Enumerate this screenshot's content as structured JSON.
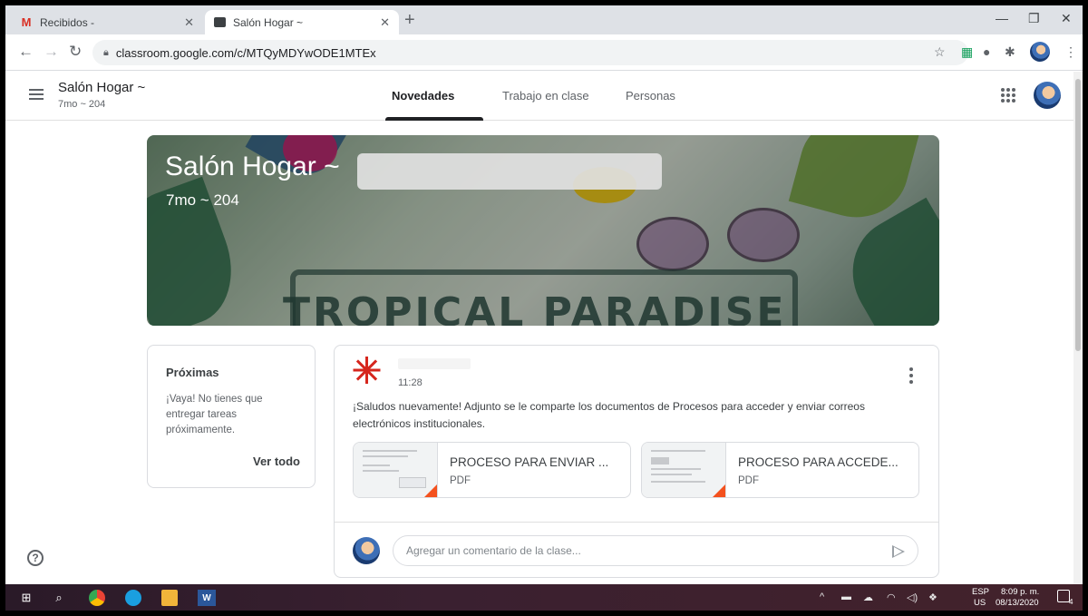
{
  "browser": {
    "tabs": [
      {
        "label": "Recibidos - ",
        "favicon": "M",
        "state": "inactive"
      },
      {
        "label": "Salón Hogar ~ ",
        "state": "active"
      }
    ],
    "url": "classroom.google.com/c/MTQyMDYwODE1MTEx"
  },
  "header": {
    "class_name": "Salón Hogar ~",
    "section": "7mo ~ 204",
    "tabs": [
      "Novedades",
      "Trabajo en clase",
      "Personas"
    ],
    "active_tab": "Novedades"
  },
  "banner": {
    "title": "Salón Hogar ~",
    "subtitle": "7mo ~ 204",
    "theme_text": "TROPICAL PARADISE"
  },
  "upcoming": {
    "title": "Próximas",
    "message": "¡Vaya! No tienes que entregar tareas próximamente.",
    "link": "Ver todo"
  },
  "post": {
    "time": "11:28",
    "body": "¡Saludos nuevamente! Adjunto se le comparte los documentos de Procesos para acceder y enviar correos electrónicos institucionales.",
    "attachments": [
      {
        "title": "PROCESO PARA ENVIAR ...",
        "type": "PDF"
      },
      {
        "title": "PROCESO PARA ACCEDE...",
        "type": "PDF"
      }
    ],
    "comment_placeholder": "Agregar un comentario de la clase..."
  },
  "taskbar": {
    "lang_top": "ESP",
    "lang_bottom": "US",
    "time": "8:09 p. m.",
    "date": "08/13/2020",
    "notification_count": "4"
  },
  "colors": {
    "accent": "#202124",
    "file_badge": "#f4511e",
    "asterisk_avatar": "#d6261d"
  }
}
